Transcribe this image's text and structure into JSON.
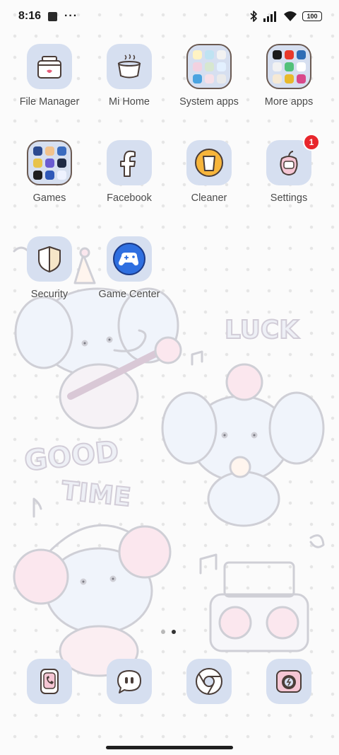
{
  "status_bar": {
    "time": "8:16",
    "more": "···",
    "battery": "100",
    "icons": [
      "app-notification-icon",
      "bluetooth-icon",
      "signal-icon",
      "wifi-icon",
      "battery-icon"
    ]
  },
  "home": {
    "apps": [
      {
        "label": "File Manager",
        "icon": "file-manager-icon"
      },
      {
        "label": "Mi Home",
        "icon": "mi-home-icon"
      },
      {
        "label": "System apps",
        "icon": "folder-icon"
      },
      {
        "label": "More apps",
        "icon": "folder-icon"
      },
      {
        "label": "Games",
        "icon": "folder-icon"
      },
      {
        "label": "Facebook",
        "icon": "facebook-icon"
      },
      {
        "label": "Cleaner",
        "icon": "cleaner-icon"
      },
      {
        "label": "Settings",
        "icon": "settings-icon",
        "badge": "1"
      },
      {
        "label": "Security",
        "icon": "security-icon"
      },
      {
        "label": "Game Center",
        "icon": "game-center-icon"
      }
    ]
  },
  "wallpaper": {
    "text": [
      "LUCK",
      "GOOD",
      "TIME"
    ]
  },
  "dock": {
    "apps": [
      {
        "icon": "phone-icon"
      },
      {
        "icon": "messages-icon"
      },
      {
        "icon": "chrome-icon"
      },
      {
        "icon": "camera-icon"
      }
    ]
  },
  "pages": {
    "count": 2,
    "active": 2
  },
  "colors": {
    "tile": "#d6dff0",
    "badge": "#e8262c",
    "label": "#4a4a4a"
  }
}
